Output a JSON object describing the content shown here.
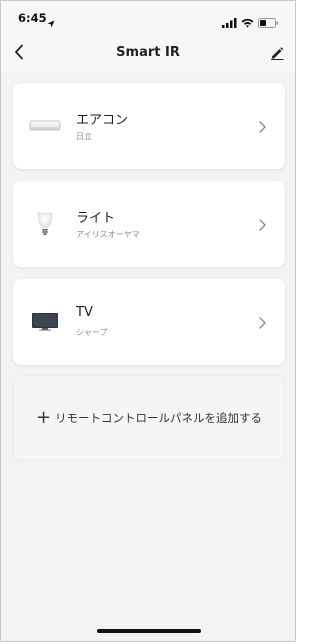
{
  "status_bar": {
    "time": "6:45",
    "icons": [
      "location-arrow-icon",
      "signal-icon",
      "wifi-icon",
      "battery-icon"
    ]
  },
  "nav": {
    "title": "Smart IR",
    "back_icon": "chevron-left-icon",
    "edit_icon": "pencil-icon"
  },
  "devices": [
    {
      "name": "エアコン",
      "subtitle": "日立",
      "icon": "air-conditioner-icon"
    },
    {
      "name": "ライト",
      "subtitle": "アイリスオーヤマ",
      "icon": "light-bulb-icon"
    },
    {
      "name": "TV",
      "subtitle": "シャープ",
      "icon": "tv-icon"
    }
  ],
  "add_remote": {
    "plus": "+",
    "label": "リモートコントロールパネルを追加する"
  },
  "colors": {
    "background": "#f3f3f3",
    "card": "#ffffff",
    "text_primary": "#1e1e1e",
    "text_secondary": "#8a8a8a"
  }
}
